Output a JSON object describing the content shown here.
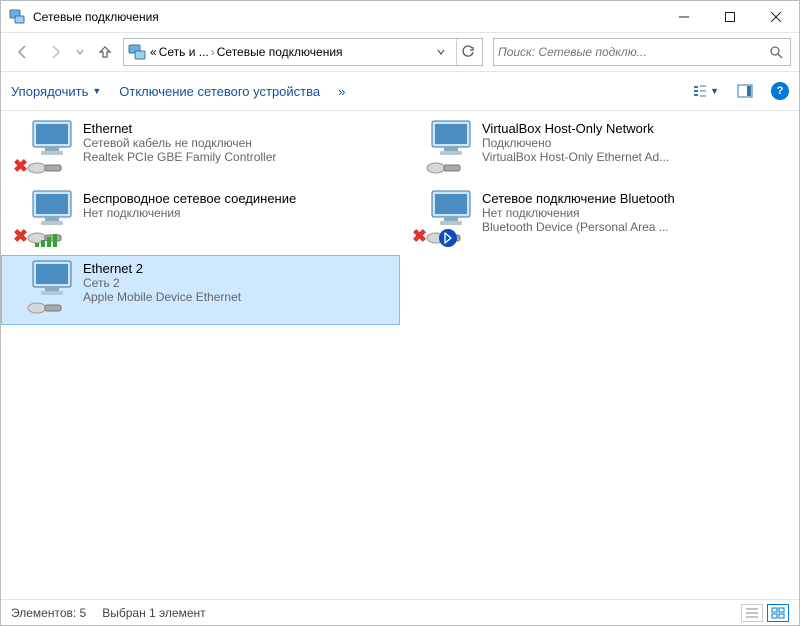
{
  "window": {
    "title": "Сетевые подключения"
  },
  "breadcrumb": {
    "root": "«",
    "primary": "Сеть и ...",
    "current": "Сетевые подключения"
  },
  "search": {
    "placeholder": "Поиск: Сетевые подклю..."
  },
  "toolbar": {
    "organize": "Упорядочить",
    "disable_device": "Отключение сетевого устройства",
    "overflow": "»"
  },
  "connections": [
    {
      "title": "Ethernet",
      "line2": "Сетевой кабель не подключен",
      "line3": "Realtek PCIe GBE Family Controller",
      "error_overlay": true,
      "signal_overlay": false,
      "bluetooth_overlay": false,
      "selected": false
    },
    {
      "title": "VirtualBox Host-Only Network",
      "line2": "Подключено",
      "line3": "VirtualBox Host-Only Ethernet Ad...",
      "error_overlay": false,
      "signal_overlay": false,
      "bluetooth_overlay": false,
      "selected": false
    },
    {
      "title": "Беспроводное сетевое соединение",
      "line2": "Нет подключения",
      "line3": "",
      "error_overlay": true,
      "signal_overlay": true,
      "bluetooth_overlay": false,
      "selected": false
    },
    {
      "title": "Сетевое подключение Bluetooth",
      "line2": "Нет подключения",
      "line3": "Bluetooth Device (Personal Area ...",
      "error_overlay": true,
      "signal_overlay": false,
      "bluetooth_overlay": true,
      "selected": false
    },
    {
      "title": "Ethernet 2",
      "line2": "Сеть 2",
      "line3": "Apple Mobile Device Ethernet",
      "error_overlay": false,
      "signal_overlay": false,
      "bluetooth_overlay": false,
      "selected": true
    }
  ],
  "statusbar": {
    "elements": "Элементов: 5",
    "selected": "Выбран 1 элемент"
  }
}
